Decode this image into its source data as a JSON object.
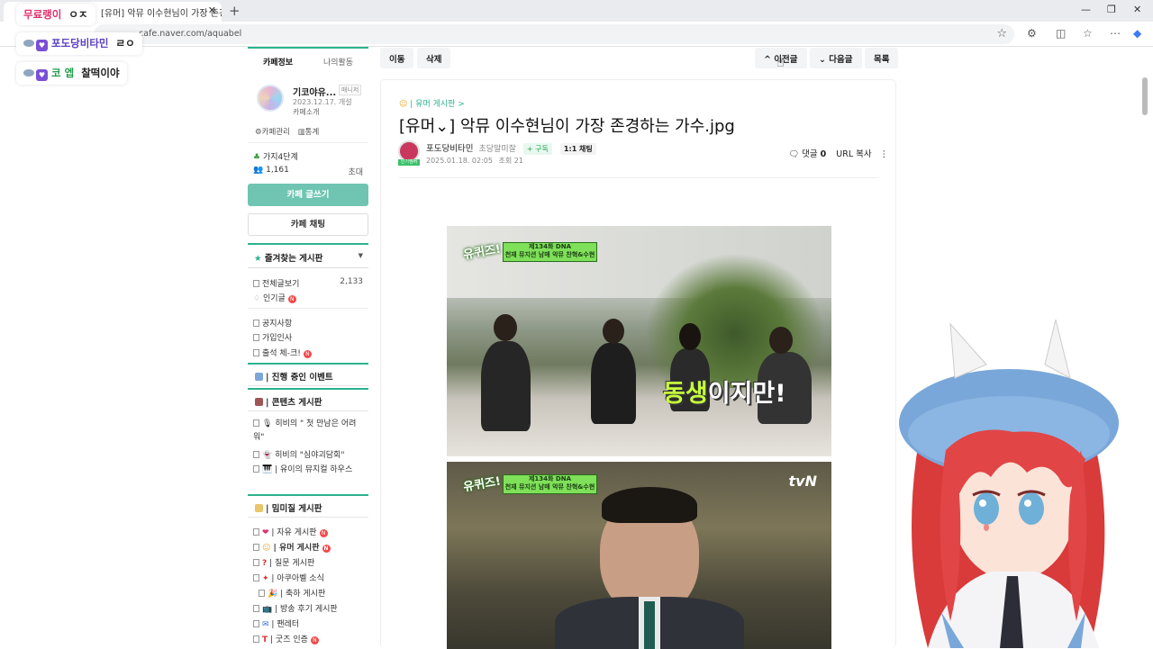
{
  "browser": {
    "tab_title": "[유머] 악뮤 이수현님이 가장 존경하는 가수",
    "tab_close": "✕",
    "new_tab": "+",
    "url": "cafe.naver.com/aquabel"
  },
  "overlay_chat": [
    {
      "name": "무료랭이",
      "text": "ㅇㅈ"
    },
    {
      "name": "포도당비타민",
      "text": "ㄹㅇ"
    },
    {
      "name": "코 엡",
      "text": "찰떡이야"
    }
  ],
  "sidebar": {
    "tabs": [
      "카페정보",
      "나의활동"
    ],
    "cafe_name": "기코야유...",
    "manager_badge": "매니저",
    "cafe_opened": "2023.12.17. 개설",
    "cafe_intro": "카페소개",
    "cafe_manage": "카페관리",
    "stats": "통계",
    "level": "가지4단계",
    "member_count": "1,161",
    "invite": "초대",
    "write_button": "카페 글쓰기",
    "chat_button": "카페 채팅",
    "favorites_label": "즐겨찾는 게시판",
    "all_posts": "전체글보기",
    "all_posts_count": "2,133",
    "popular": "인기글",
    "notice": "공지사항",
    "greet": "가입인사",
    "attend": "출석 체-크!",
    "group_event": "| 진행 중인 이벤트",
    "group_contents": "| 콘텐츠 게시판",
    "content_items": [
      "히비의 \" 첫 만남은 어려워\"",
      "히비의 \"심야괴담회\"",
      "| 유이의 뮤지컬 하우스"
    ],
    "group_chat": "| 밈미질 게시판",
    "board_items": [
      "| 자유 게시판",
      "| 유머 게시판",
      "| 질문 게시판",
      "| 아쿠아벨 소식",
      "| 축하 게시판",
      "| 방송 후기 게시판",
      "| 팬레터",
      "| 굿즈 인증"
    ]
  },
  "article": {
    "btn_move": "이동",
    "btn_delete": "삭제",
    "btn_prev": "이전글",
    "btn_next": "다음글",
    "btn_list": "목록",
    "breadcrumb": "| 유머 게시판 >",
    "title": "[유머⌄] 악뮤 이수현님이 가장 존경하는 가수.jpg",
    "author": "포도당비타민",
    "author_rank": "초당말미잘",
    "subscribe": "+ 구독",
    "chat": "1:1 채팅",
    "date": "2025.01.18. 02:05",
    "views": "조회 21",
    "comments_label": "댓글",
    "comments_count": "0",
    "url_copy": "URL 복사"
  },
  "video": {
    "banner_top": "제134화 DNA",
    "banner_sub": "천재 뮤지션 남매 악뮤 찬혁&수현",
    "show_logo": "유퀴즈!",
    "caption_highlight": "동생",
    "caption_rest": "이지만!",
    "network": "tvN"
  }
}
